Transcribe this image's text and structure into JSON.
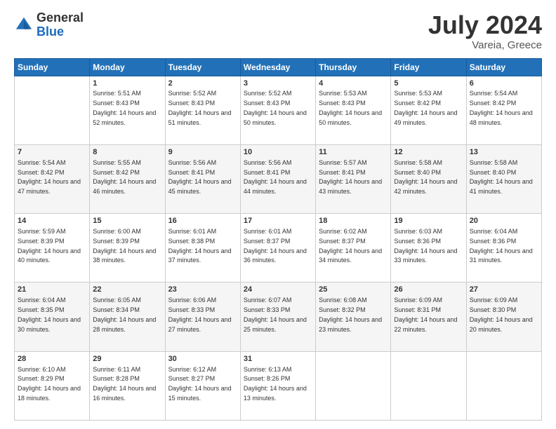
{
  "header": {
    "logo_general": "General",
    "logo_blue": "Blue",
    "title": "July 2024",
    "location": "Vareia, Greece"
  },
  "weekdays": [
    "Sunday",
    "Monday",
    "Tuesday",
    "Wednesday",
    "Thursday",
    "Friday",
    "Saturday"
  ],
  "weeks": [
    [
      {
        "day": "",
        "sunrise": "",
        "sunset": "",
        "daylight": ""
      },
      {
        "day": "1",
        "sunrise": "5:51 AM",
        "sunset": "8:43 PM",
        "daylight": "14 hours and 52 minutes."
      },
      {
        "day": "2",
        "sunrise": "5:52 AM",
        "sunset": "8:43 PM",
        "daylight": "14 hours and 51 minutes."
      },
      {
        "day": "3",
        "sunrise": "5:52 AM",
        "sunset": "8:43 PM",
        "daylight": "14 hours and 50 minutes."
      },
      {
        "day": "4",
        "sunrise": "5:53 AM",
        "sunset": "8:43 PM",
        "daylight": "14 hours and 50 minutes."
      },
      {
        "day": "5",
        "sunrise": "5:53 AM",
        "sunset": "8:42 PM",
        "daylight": "14 hours and 49 minutes."
      },
      {
        "day": "6",
        "sunrise": "5:54 AM",
        "sunset": "8:42 PM",
        "daylight": "14 hours and 48 minutes."
      }
    ],
    [
      {
        "day": "7",
        "sunrise": "5:54 AM",
        "sunset": "8:42 PM",
        "daylight": "14 hours and 47 minutes."
      },
      {
        "day": "8",
        "sunrise": "5:55 AM",
        "sunset": "8:42 PM",
        "daylight": "14 hours and 46 minutes."
      },
      {
        "day": "9",
        "sunrise": "5:56 AM",
        "sunset": "8:41 PM",
        "daylight": "14 hours and 45 minutes."
      },
      {
        "day": "10",
        "sunrise": "5:56 AM",
        "sunset": "8:41 PM",
        "daylight": "14 hours and 44 minutes."
      },
      {
        "day": "11",
        "sunrise": "5:57 AM",
        "sunset": "8:41 PM",
        "daylight": "14 hours and 43 minutes."
      },
      {
        "day": "12",
        "sunrise": "5:58 AM",
        "sunset": "8:40 PM",
        "daylight": "14 hours and 42 minutes."
      },
      {
        "day": "13",
        "sunrise": "5:58 AM",
        "sunset": "8:40 PM",
        "daylight": "14 hours and 41 minutes."
      }
    ],
    [
      {
        "day": "14",
        "sunrise": "5:59 AM",
        "sunset": "8:39 PM",
        "daylight": "14 hours and 40 minutes."
      },
      {
        "day": "15",
        "sunrise": "6:00 AM",
        "sunset": "8:39 PM",
        "daylight": "14 hours and 38 minutes."
      },
      {
        "day": "16",
        "sunrise": "6:01 AM",
        "sunset": "8:38 PM",
        "daylight": "14 hours and 37 minutes."
      },
      {
        "day": "17",
        "sunrise": "6:01 AM",
        "sunset": "8:37 PM",
        "daylight": "14 hours and 36 minutes."
      },
      {
        "day": "18",
        "sunrise": "6:02 AM",
        "sunset": "8:37 PM",
        "daylight": "14 hours and 34 minutes."
      },
      {
        "day": "19",
        "sunrise": "6:03 AM",
        "sunset": "8:36 PM",
        "daylight": "14 hours and 33 minutes."
      },
      {
        "day": "20",
        "sunrise": "6:04 AM",
        "sunset": "8:36 PM",
        "daylight": "14 hours and 31 minutes."
      }
    ],
    [
      {
        "day": "21",
        "sunrise": "6:04 AM",
        "sunset": "8:35 PM",
        "daylight": "14 hours and 30 minutes."
      },
      {
        "day": "22",
        "sunrise": "6:05 AM",
        "sunset": "8:34 PM",
        "daylight": "14 hours and 28 minutes."
      },
      {
        "day": "23",
        "sunrise": "6:06 AM",
        "sunset": "8:33 PM",
        "daylight": "14 hours and 27 minutes."
      },
      {
        "day": "24",
        "sunrise": "6:07 AM",
        "sunset": "8:33 PM",
        "daylight": "14 hours and 25 minutes."
      },
      {
        "day": "25",
        "sunrise": "6:08 AM",
        "sunset": "8:32 PM",
        "daylight": "14 hours and 23 minutes."
      },
      {
        "day": "26",
        "sunrise": "6:09 AM",
        "sunset": "8:31 PM",
        "daylight": "14 hours and 22 minutes."
      },
      {
        "day": "27",
        "sunrise": "6:09 AM",
        "sunset": "8:30 PM",
        "daylight": "14 hours and 20 minutes."
      }
    ],
    [
      {
        "day": "28",
        "sunrise": "6:10 AM",
        "sunset": "8:29 PM",
        "daylight": "14 hours and 18 minutes."
      },
      {
        "day": "29",
        "sunrise": "6:11 AM",
        "sunset": "8:28 PM",
        "daylight": "14 hours and 16 minutes."
      },
      {
        "day": "30",
        "sunrise": "6:12 AM",
        "sunset": "8:27 PM",
        "daylight": "14 hours and 15 minutes."
      },
      {
        "day": "31",
        "sunrise": "6:13 AM",
        "sunset": "8:26 PM",
        "daylight": "14 hours and 13 minutes."
      },
      {
        "day": "",
        "sunrise": "",
        "sunset": "",
        "daylight": ""
      },
      {
        "day": "",
        "sunrise": "",
        "sunset": "",
        "daylight": ""
      },
      {
        "day": "",
        "sunrise": "",
        "sunset": "",
        "daylight": ""
      }
    ]
  ]
}
